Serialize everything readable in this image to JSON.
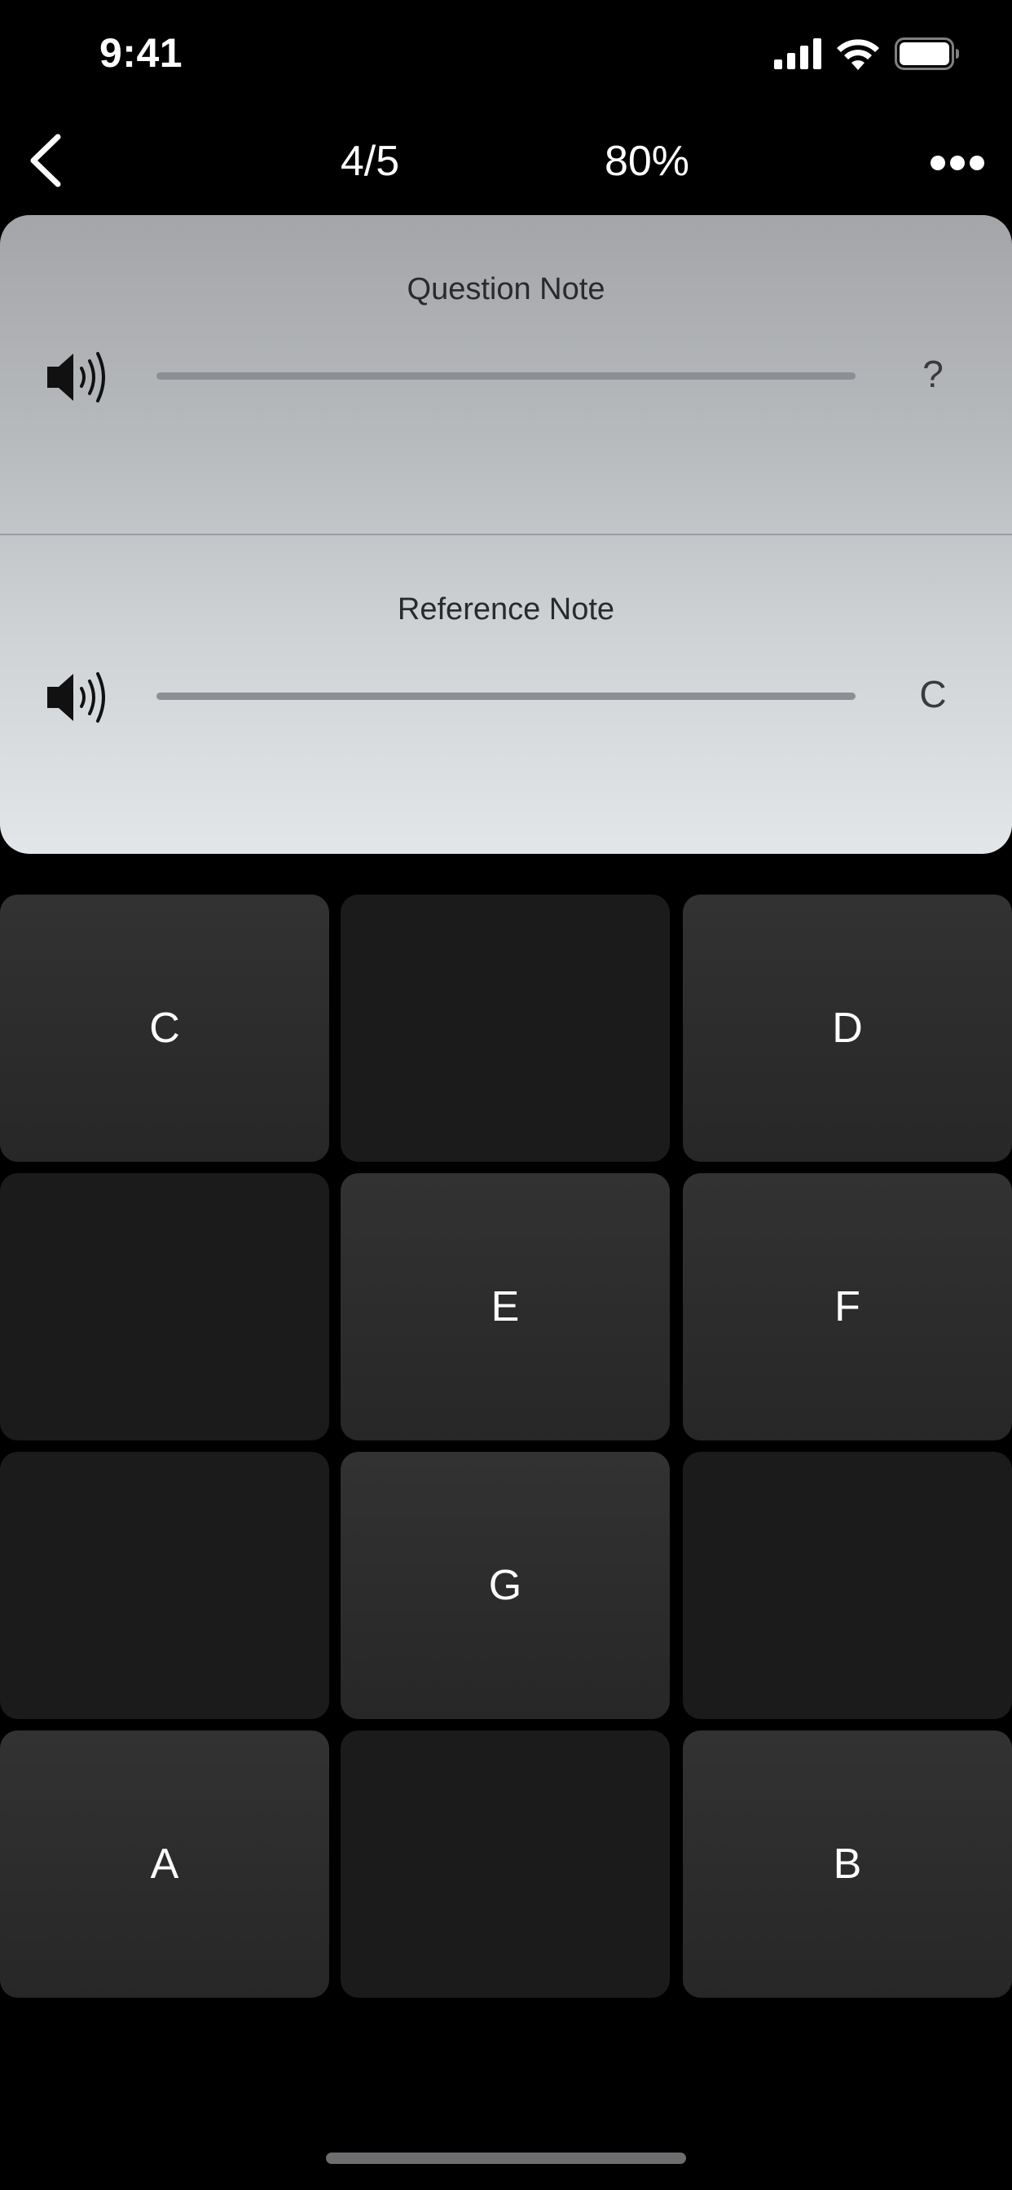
{
  "status_bar": {
    "time": "9:41",
    "icons": [
      "cellular-signal-icon",
      "wifi-icon",
      "battery-icon"
    ]
  },
  "nav": {
    "back_icon": "chevron-left-icon",
    "progress": "4/5",
    "score": "80%",
    "more_icon": "ellipsis-icon"
  },
  "player": {
    "question": {
      "title": "Question Note",
      "answer": "?",
      "icon": "speaker-icon"
    },
    "reference": {
      "title": "Reference Note",
      "answer": "C",
      "icon": "speaker-icon"
    }
  },
  "grid": {
    "keys": [
      {
        "label": "C",
        "active": true
      },
      {
        "label": "",
        "active": false
      },
      {
        "label": "D",
        "active": true
      },
      {
        "label": "",
        "active": false
      },
      {
        "label": "E",
        "active": true
      },
      {
        "label": "F",
        "active": true
      },
      {
        "label": "",
        "active": false
      },
      {
        "label": "G",
        "active": true
      },
      {
        "label": "",
        "active": false
      },
      {
        "label": "A",
        "active": true
      },
      {
        "label": "",
        "active": false
      },
      {
        "label": "B",
        "active": true
      }
    ]
  },
  "colors": {
    "background": "#000000",
    "key_active": "#2f2f2f",
    "key_inactive": "#1b1b1b",
    "card_top": "#a4a5a8",
    "card_bottom": "#e3e6e9"
  }
}
